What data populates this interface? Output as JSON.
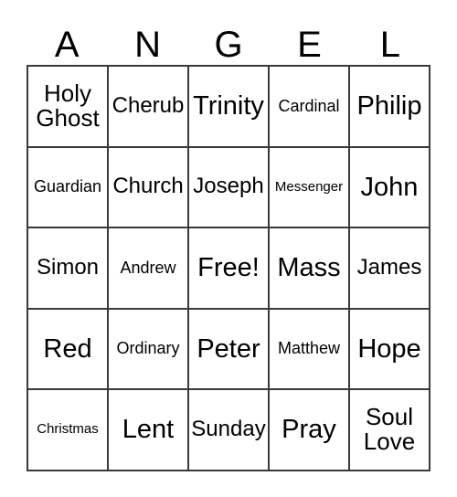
{
  "card": {
    "title_letters": [
      "A",
      "N",
      "G",
      "E",
      "L"
    ],
    "columns": [
      "A",
      "N",
      "G",
      "E",
      "L"
    ],
    "free_space": "Free!",
    "border_color": "#3a3a3a",
    "text_color": "#000000",
    "background_color": "#ffffff",
    "rows": [
      [
        {
          "label": "Holy Ghost",
          "size": "sz-wrap"
        },
        {
          "label": "Cherub",
          "size": "sz-md"
        },
        {
          "label": "Trinity",
          "size": "sz-xl"
        },
        {
          "label": "Cardinal",
          "size": "sz-sm"
        },
        {
          "label": "Philip",
          "size": "sz-xl"
        }
      ],
      [
        {
          "label": "Guardian",
          "size": "sz-sm"
        },
        {
          "label": "Church",
          "size": "sz-md"
        },
        {
          "label": "Joseph",
          "size": "sz-md"
        },
        {
          "label": "Messenger",
          "size": "sz-xs"
        },
        {
          "label": "John",
          "size": "sz-xl"
        }
      ],
      [
        {
          "label": "Simon",
          "size": "sz-md"
        },
        {
          "label": "Andrew",
          "size": "sz-sm"
        },
        {
          "label": "Free!",
          "size": "sz-xl"
        },
        {
          "label": "Mass",
          "size": "sz-xl"
        },
        {
          "label": "James",
          "size": "sz-md"
        }
      ],
      [
        {
          "label": "Red",
          "size": "sz-xl"
        },
        {
          "label": "Ordinary",
          "size": "sz-sm"
        },
        {
          "label": "Peter",
          "size": "sz-xl"
        },
        {
          "label": "Matthew",
          "size": "sz-sm"
        },
        {
          "label": "Hope",
          "size": "sz-xl"
        }
      ],
      [
        {
          "label": "Christmas",
          "size": "sz-xs"
        },
        {
          "label": "Lent",
          "size": "sz-xl"
        },
        {
          "label": "Sunday",
          "size": "sz-md"
        },
        {
          "label": "Pray",
          "size": "sz-xl"
        },
        {
          "label": "Soul Love",
          "size": "sz-wrap"
        }
      ]
    ]
  }
}
